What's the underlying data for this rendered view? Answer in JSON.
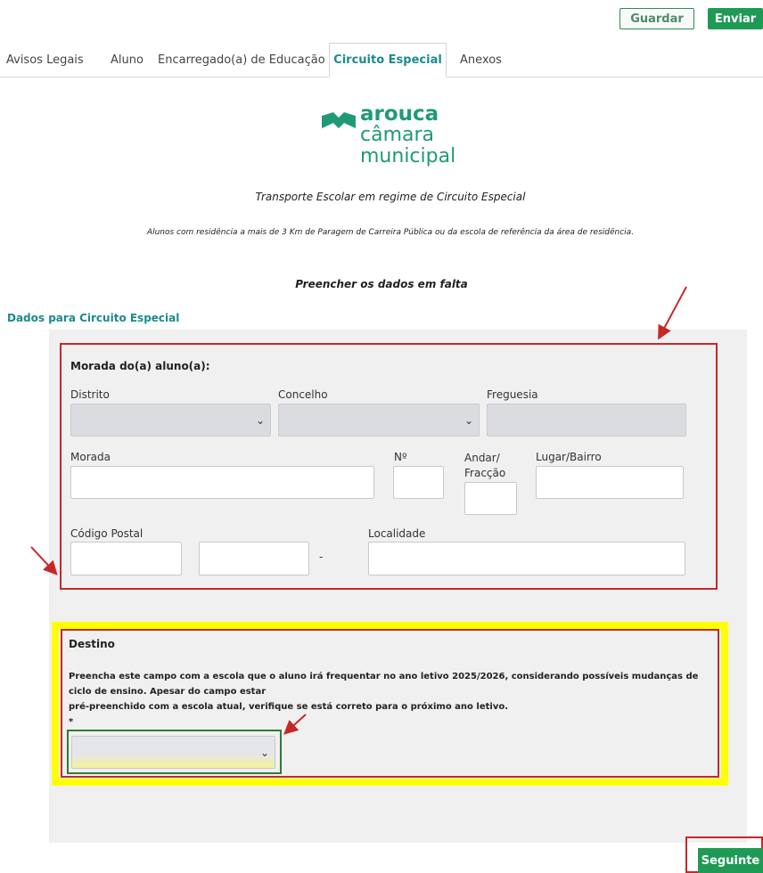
{
  "actions": {
    "save_label": "Guardar",
    "send_label": "Enviar",
    "next_label": "Seguinte"
  },
  "tabs": [
    {
      "label": "Avisos Legais"
    },
    {
      "label": "Aluno"
    },
    {
      "label": "Encarregado(a) de Educação"
    },
    {
      "label": "Circuito Especial"
    },
    {
      "label": "Anexos"
    }
  ],
  "active_tab": "Circuito Especial",
  "logo": {
    "line1": "arouca",
    "line2": "câmara",
    "line3": "municipal",
    "color": "#1f9a75"
  },
  "header": {
    "title": "Transporte Escolar em regime de Circuito Especial",
    "subtitle": "Alunos com residência a mais de 3 Km de Paragem de Carreira Pública ou da escola de referência da área de residência.",
    "instruction": "Preencher os dados em falta"
  },
  "section": {
    "title": "Dados para Circuito Especial"
  },
  "address": {
    "heading": "Morada do(a) aluno(a):",
    "distrito_label": "Distrito",
    "concelho_label": "Concelho",
    "freguesia_label": "Freguesia",
    "morada_label": "Morada",
    "numero_label": "Nº",
    "andar_label_1": "Andar/",
    "andar_label_2": "Fracção",
    "lugar_label": "Lugar/Bairro",
    "codigo_postal_label": "Código Postal",
    "cp_separator": "-",
    "localidade_label": "Localidade"
  },
  "destino": {
    "heading": "Destino",
    "help_line1": "Preencha este campo com a escola que o aluno irá frequentar no ano letivo 2025/2026, considerando possíveis mudanças de ciclo de ensino. Apesar do campo estar",
    "help_line2": "pré-preenchido com a escola atual, verifique se está correto para o próximo ano letivo.",
    "required_mark": "*"
  },
  "colors": {
    "accent_teal": "#1a8a8e",
    "button_green": "#1e9a55",
    "annotation_red": "#c62828",
    "highlight_yellow": "#ffff00",
    "highlight_green": "#2e7d32"
  }
}
